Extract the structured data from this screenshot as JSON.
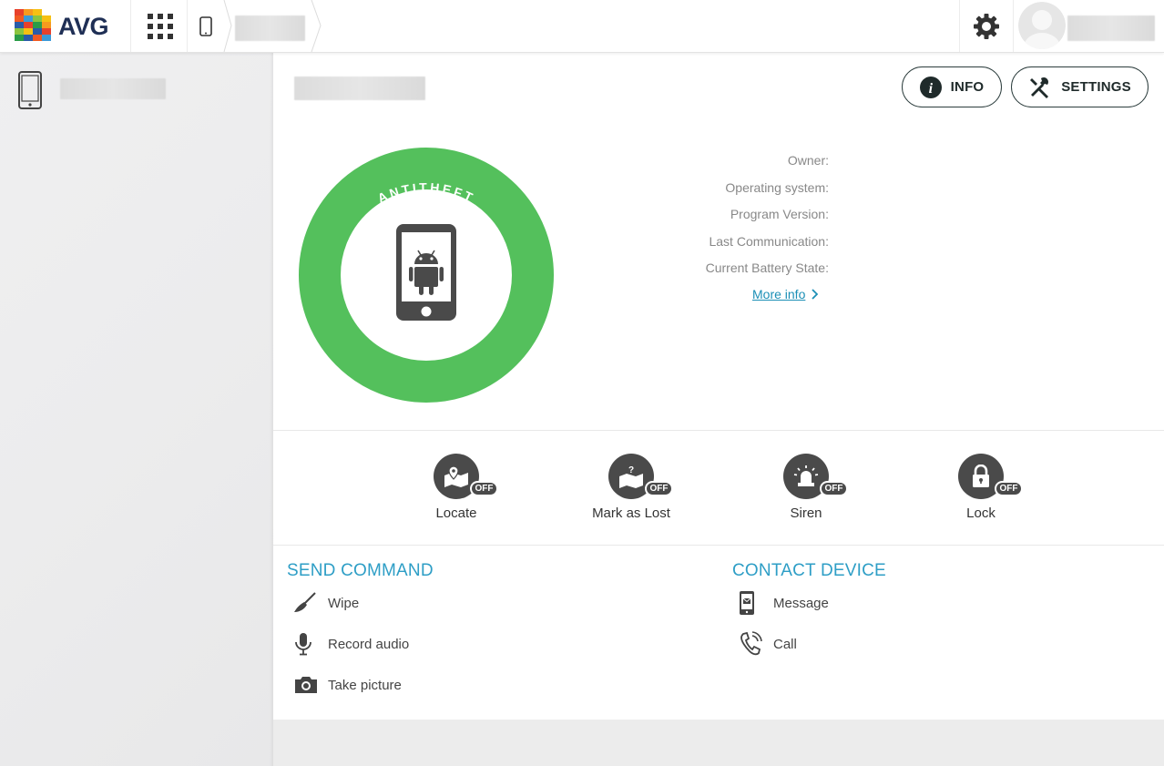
{
  "header": {
    "logo_text": "AVG",
    "icons": {
      "apps": "apps-grid-icon",
      "device": "smartphone-icon",
      "settings": "gear-icon",
      "avatar": "user-avatar"
    }
  },
  "main": {
    "buttons": {
      "info_label": "INFO",
      "settings_label": "SETTINGS"
    },
    "status_ring": {
      "label": "ANTITHEFT",
      "color": "#54c05c"
    },
    "details": {
      "owner_label": "Owner:",
      "os_label": "Operating system:",
      "version_label": "Program Version:",
      "last_comm_label": "Last Communication:",
      "battery_label": "Current Battery State:",
      "more_info_label": "More info"
    },
    "features": [
      {
        "label": "Locate",
        "state": "OFF",
        "icon": "locate-map-icon"
      },
      {
        "label": "Mark as Lost",
        "state": "OFF",
        "icon": "lost-map-icon"
      },
      {
        "label": "Siren",
        "state": "OFF",
        "icon": "siren-icon"
      },
      {
        "label": "Lock",
        "state": "OFF",
        "icon": "lock-icon"
      }
    ],
    "send_command": {
      "title": "SEND COMMAND",
      "items": [
        {
          "label": "Wipe",
          "icon": "broom-icon"
        },
        {
          "label": "Record audio",
          "icon": "microphone-icon"
        },
        {
          "label": "Take picture",
          "icon": "camera-icon"
        }
      ]
    },
    "contact_device": {
      "title": "CONTACT DEVICE",
      "items": [
        {
          "label": "Message",
          "icon": "message-phone-icon"
        },
        {
          "label": "Call",
          "icon": "phone-call-icon"
        }
      ]
    }
  },
  "colors": {
    "accent": "#2e9ec6",
    "link": "#1b8fb6",
    "ring_green": "#54c05c",
    "dark_icon": "#4a4a4a"
  }
}
